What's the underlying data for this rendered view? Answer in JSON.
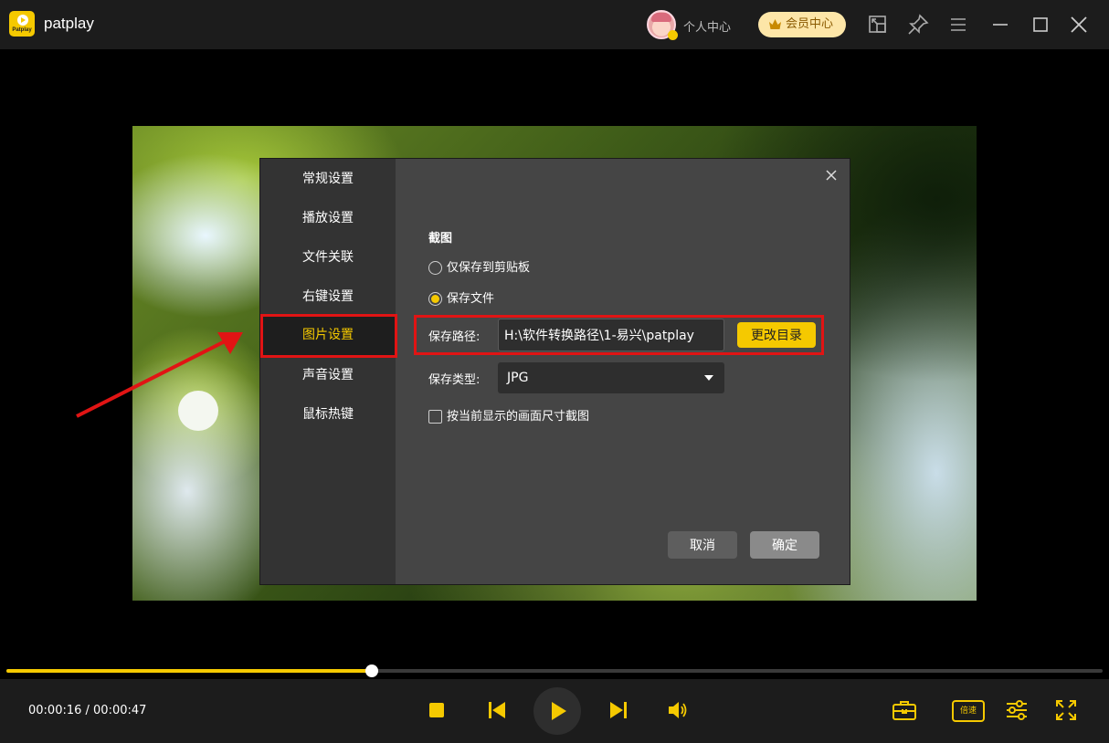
{
  "app": {
    "name": "patplay",
    "logo_text": "Patplay"
  },
  "titlebar": {
    "user_center": "个人中心",
    "vip_center": "会员中心"
  },
  "settings": {
    "sidebar": [
      {
        "label": "常规设置"
      },
      {
        "label": "播放设置"
      },
      {
        "label": "文件关联"
      },
      {
        "label": "右键设置"
      },
      {
        "label": "图片设置"
      },
      {
        "label": "声音设置"
      },
      {
        "label": "鼠标热键"
      }
    ],
    "active_index": 4,
    "section_title": "截图",
    "option_clipboard": "仅保存到剪贴板",
    "option_file": "保存文件",
    "selected_option": "option_file",
    "save_path_label": "保存路径:",
    "save_path_value": "H:\\软件转换路径\\1-易兴\\patplay",
    "change_dir_label": "更改目录",
    "save_type_label": "保存类型:",
    "save_type_value": "JPG",
    "current_size_label": "按当前显示的画面尺寸截图",
    "current_size_checked": false,
    "cancel_label": "取消",
    "ok_label": "确定"
  },
  "player": {
    "time_text": "00:00:16 / 00:00:47",
    "progress_fraction": 0.3333,
    "speed_label": "倍速"
  },
  "colors": {
    "accent": "#f5c900",
    "highlight": "#e11414"
  }
}
